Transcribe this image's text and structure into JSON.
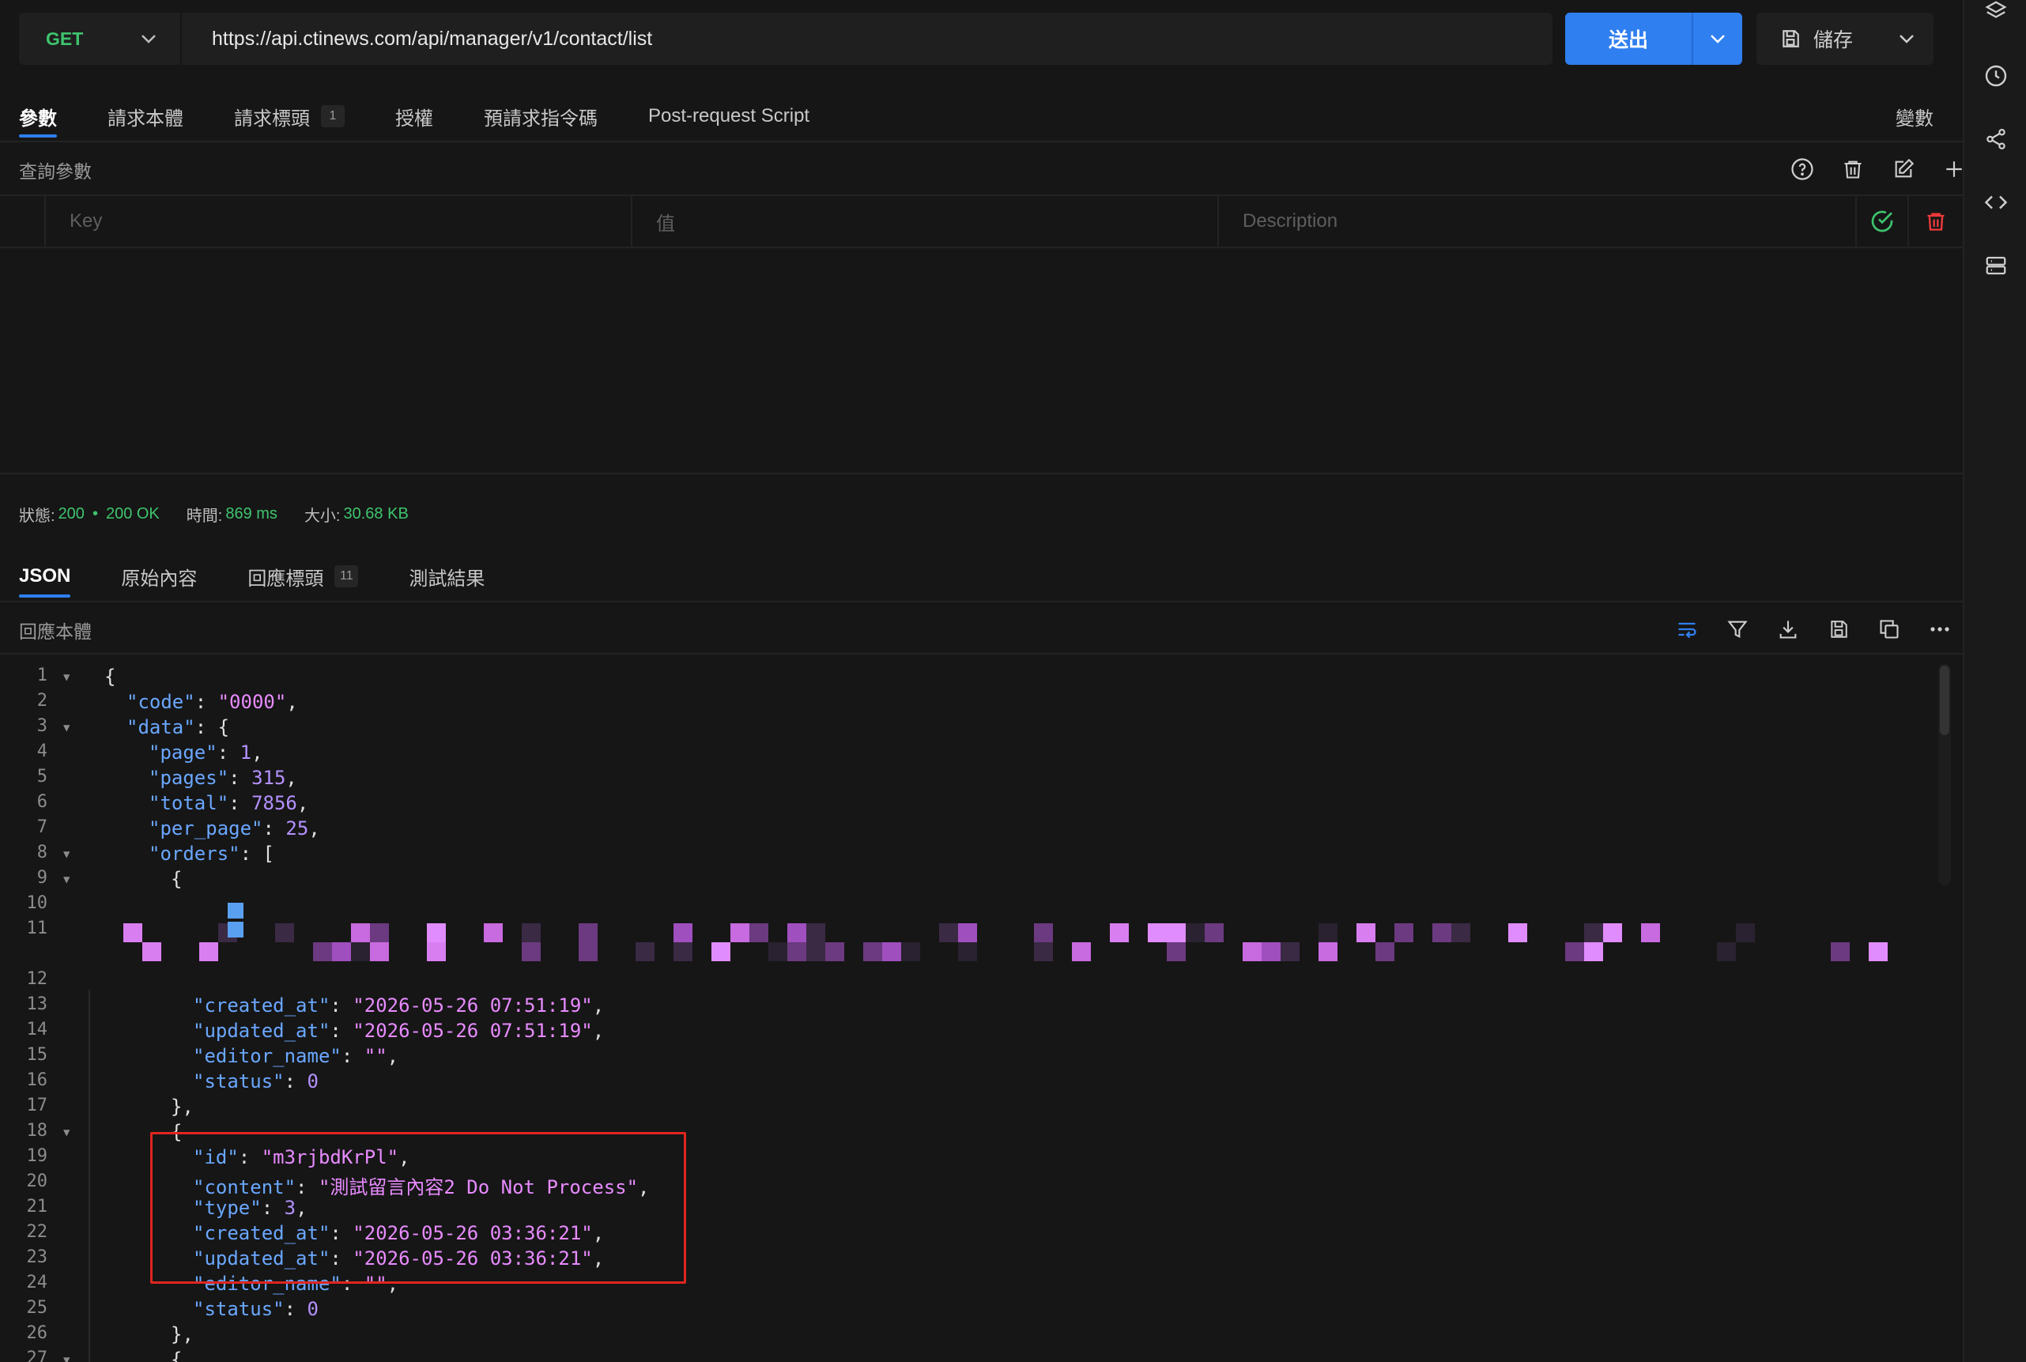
{
  "request": {
    "method": "GET",
    "url": "https://api.ctinews.com/api/manager/v1/contact/list",
    "send_label": "送出",
    "save_label": "儲存",
    "variables_label": "變數"
  },
  "request_tabs": [
    {
      "label": "參數",
      "active": true
    },
    {
      "label": "請求本體"
    },
    {
      "label": "請求標頭",
      "badge": "1"
    },
    {
      "label": "授權"
    },
    {
      "label": "預請求指令碼"
    },
    {
      "label": "Post-request Script"
    }
  ],
  "query": {
    "title": "查詢參數",
    "key_placeholder": "Key",
    "value_placeholder": "值",
    "description_placeholder": "Description"
  },
  "status": {
    "status_label": "狀態:",
    "code": "200",
    "text": "200 OK",
    "time_label": "時間:",
    "time": "869 ms",
    "size_label": "大小:",
    "size": "30.68 KB"
  },
  "response_tabs": [
    {
      "label": "JSON",
      "active": true
    },
    {
      "label": "原始內容"
    },
    {
      "label": "回應標頭",
      "badge": "11"
    },
    {
      "label": "測試結果"
    }
  ],
  "response": {
    "title": "回應本體"
  },
  "code_lines": [
    {
      "n": "1",
      "fold": true,
      "indent": 0,
      "tokens": [
        [
          "p",
          "{"
        ]
      ]
    },
    {
      "n": "2",
      "indent": 1,
      "tokens": [
        [
          "k",
          "\"code\""
        ],
        [
          "p",
          ": "
        ],
        [
          "s",
          "\"0000\""
        ],
        [
          "p",
          ","
        ]
      ]
    },
    {
      "n": "3",
      "fold": true,
      "indent": 1,
      "tokens": [
        [
          "k",
          "\"data\""
        ],
        [
          "p",
          ": {"
        ]
      ]
    },
    {
      "n": "4",
      "indent": 2,
      "tokens": [
        [
          "k",
          "\"page\""
        ],
        [
          "p",
          ": "
        ],
        [
          "n",
          "1"
        ],
        [
          "p",
          ","
        ]
      ]
    },
    {
      "n": "5",
      "indent": 2,
      "tokens": [
        [
          "k",
          "\"pages\""
        ],
        [
          "p",
          ": "
        ],
        [
          "n",
          "315"
        ],
        [
          "p",
          ","
        ]
      ]
    },
    {
      "n": "6",
      "indent": 2,
      "tokens": [
        [
          "k",
          "\"total\""
        ],
        [
          "p",
          ": "
        ],
        [
          "n",
          "7856"
        ],
        [
          "p",
          ","
        ]
      ]
    },
    {
      "n": "7",
      "indent": 2,
      "tokens": [
        [
          "k",
          "\"per_page\""
        ],
        [
          "p",
          ": "
        ],
        [
          "n",
          "25"
        ],
        [
          "p",
          ","
        ]
      ]
    },
    {
      "n": "8",
      "fold": true,
      "indent": 2,
      "tokens": [
        [
          "k",
          "\"orders\""
        ],
        [
          "p",
          ": ["
        ]
      ]
    },
    {
      "n": "9",
      "fold": true,
      "indent": 3,
      "tokens": [
        [
          "p",
          "{"
        ]
      ]
    },
    {
      "n": "10",
      "indent": 0,
      "tokens": []
    },
    {
      "n": "11",
      "indent": 0,
      "tokens": [],
      "redacted": true
    },
    {
      "n": "12",
      "indent": 0,
      "tokens": []
    },
    {
      "n": "13",
      "indent": 4,
      "tokens": [
        [
          "k",
          "\"created_at\""
        ],
        [
          "p",
          ": "
        ],
        [
          "s",
          "\"2026-05-26 07:51:19\""
        ],
        [
          "p",
          ","
        ]
      ]
    },
    {
      "n": "14",
      "indent": 4,
      "tokens": [
        [
          "k",
          "\"updated_at\""
        ],
        [
          "p",
          ": "
        ],
        [
          "s",
          "\"2026-05-26 07:51:19\""
        ],
        [
          "p",
          ","
        ]
      ]
    },
    {
      "n": "15",
      "indent": 4,
      "tokens": [
        [
          "k",
          "\"editor_name\""
        ],
        [
          "p",
          ": "
        ],
        [
          "s",
          "\"\""
        ],
        [
          "p",
          ","
        ]
      ]
    },
    {
      "n": "16",
      "indent": 4,
      "tokens": [
        [
          "k",
          "\"status\""
        ],
        [
          "p",
          ": "
        ],
        [
          "n",
          "0"
        ]
      ]
    },
    {
      "n": "17",
      "indent": 3,
      "tokens": [
        [
          "p",
          "},"
        ]
      ]
    },
    {
      "n": "18",
      "fold": true,
      "indent": 3,
      "tokens": [
        [
          "p",
          "{"
        ]
      ]
    },
    {
      "n": "19",
      "indent": 4,
      "tokens": [
        [
          "k",
          "\"id\""
        ],
        [
          "p",
          ": "
        ],
        [
          "s",
          "\"m3rjbdKrPl\""
        ],
        [
          "p",
          ","
        ]
      ]
    },
    {
      "n": "20",
      "indent": 4,
      "tokens": [
        [
          "k",
          "\"content\""
        ],
        [
          "p",
          ": "
        ],
        [
          "s",
          "\"測試留言內容2 Do Not Process\""
        ],
        [
          "p",
          ","
        ]
      ]
    },
    {
      "n": "21",
      "indent": 4,
      "tokens": [
        [
          "k",
          "\"type\""
        ],
        [
          "p",
          ": "
        ],
        [
          "n",
          "3"
        ],
        [
          "p",
          ","
        ]
      ]
    },
    {
      "n": "22",
      "indent": 4,
      "tokens": [
        [
          "k",
          "\"created_at\""
        ],
        [
          "p",
          ": "
        ],
        [
          "s",
          "\"2026-05-26 03:36:21\""
        ],
        [
          "p",
          ","
        ]
      ]
    },
    {
      "n": "23",
      "indent": 4,
      "tokens": [
        [
          "k",
          "\"updated_at\""
        ],
        [
          "p",
          ": "
        ],
        [
          "s",
          "\"2026-05-26 03:36:21\""
        ],
        [
          "p",
          ","
        ]
      ]
    },
    {
      "n": "24",
      "indent": 4,
      "tokens": [
        [
          "k",
          "\"editor_name\""
        ],
        [
          "p",
          ": "
        ],
        [
          "s",
          "\"\""
        ],
        [
          "p",
          ","
        ]
      ]
    },
    {
      "n": "25",
      "indent": 4,
      "tokens": [
        [
          "k",
          "\"status\""
        ],
        [
          "p",
          ": "
        ],
        [
          "n",
          "0"
        ]
      ]
    },
    {
      "n": "26",
      "indent": 3,
      "tokens": [
        [
          "p",
          "},"
        ]
      ]
    },
    {
      "n": "27",
      "fold": true,
      "indent": 3,
      "tokens": [
        [
          "p",
          "{"
        ]
      ]
    }
  ],
  "icons": {
    "rail": [
      "layers-icon",
      "history-icon",
      "share-icon",
      "code-icon",
      "server-icon"
    ],
    "query_actions": [
      "help-icon",
      "trash-icon",
      "edit-icon",
      "plus-icon"
    ],
    "response_actions": [
      "wrap-icon",
      "filter-icon",
      "download-icon",
      "save-icon",
      "copy-icon",
      "more-icon"
    ]
  },
  "colors": {
    "accent": "#2f7ff0",
    "method_get": "#3ec46d",
    "success": "#3ec46d",
    "danger": "#ef3a3a",
    "json_key": "#6aa7ff",
    "json_string": "#e88bff",
    "json_number": "#b491ff",
    "highlight_box": "#e0261f"
  }
}
